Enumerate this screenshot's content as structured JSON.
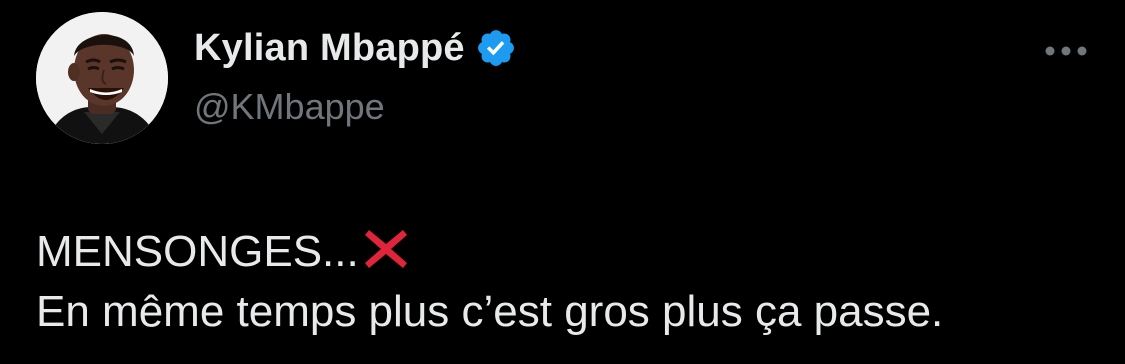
{
  "author": {
    "display_name": "Kylian Mbappé",
    "handle": "@KMbappe",
    "avatar_icon": "profile-photo",
    "verified_icon": "verified-badge-icon"
  },
  "menu": {
    "icon": "more-options-icon"
  },
  "tweet": {
    "line1": "MENSONGES...",
    "line1_emoji": "cross-mark-icon",
    "line2": "En même temps plus c’est gros plus ça passe."
  },
  "colors": {
    "background": "#000000",
    "primary_text": "#e7e9ea",
    "secondary_text": "#71767b",
    "verified": "#1d9bf0",
    "cross": "#e0243a"
  }
}
